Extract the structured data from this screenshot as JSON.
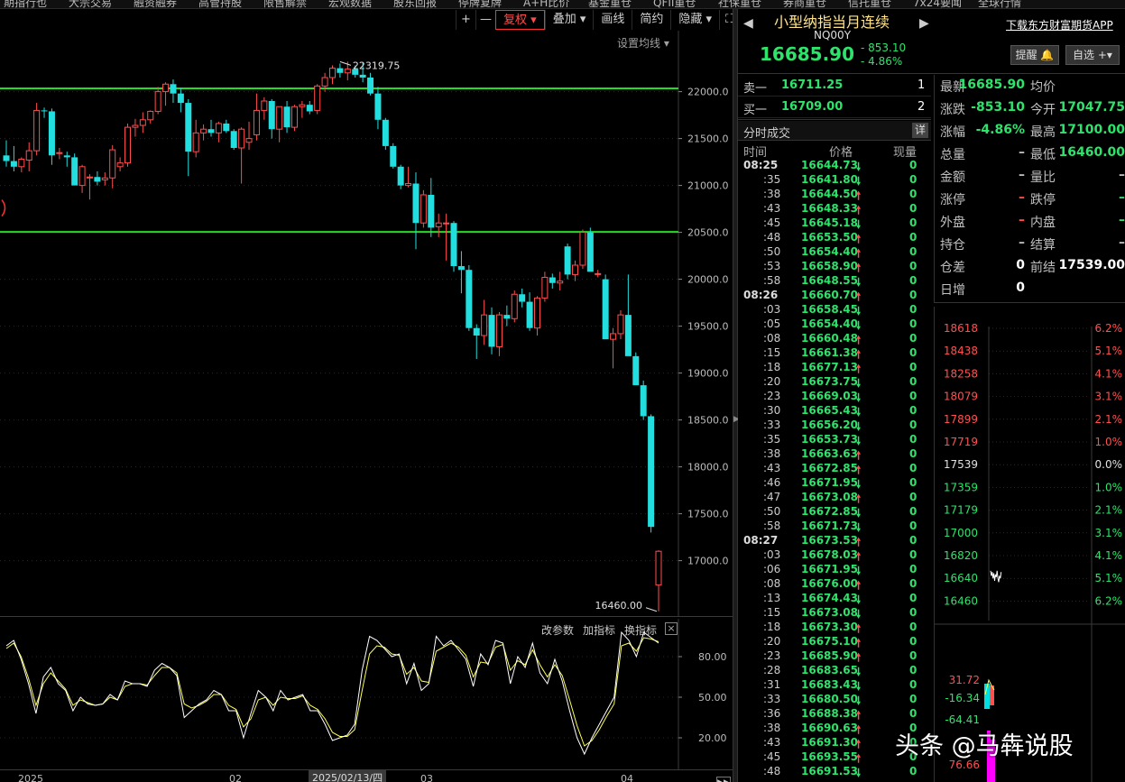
{
  "topbar": {
    "items": [
      "期指行也",
      "大宗交易",
      "融资融券",
      "高管持股",
      "限售解禁",
      "宏观数据",
      "股东回报",
      "停牌复牌",
      "A+H比价",
      "基金重仓",
      "QFII重仓",
      "社保重仓",
      "券商重仓",
      "信托重仓",
      "7x24要闻",
      "全球行情"
    ]
  },
  "toolbar": {
    "plus": "+",
    "minus": "—",
    "fuquan": "复权",
    "overlay": "叠加",
    "draw": "画线",
    "simple": "简约",
    "hide": "隐藏",
    "fullscreen": "⛶"
  },
  "setting_ma": "设置均线",
  "sub_toolbar": {
    "params": "改参数",
    "add": "加指标",
    "switch": "换指标",
    "close": "×"
  },
  "xaxis": {
    "labels": [
      "2025",
      "02",
      "03",
      "04"
    ],
    "cursor": "2025/02/13/四"
  },
  "quote": {
    "title": "小型纳指当月连续",
    "code": "NQ00Y",
    "last": "16685.90",
    "change": "- 853.10",
    "change_pct": "- 4.86%",
    "download": "下载东方财富期货APP",
    "alert": "提醒 🔔",
    "fav": "自选 +▾"
  },
  "book": [
    {
      "label": "卖一",
      "price": "16711.25",
      "vol": "1"
    },
    {
      "label": "买一",
      "price": "16709.00",
      "vol": "2"
    }
  ],
  "ticks_head": {
    "title": "分时成交",
    "detail": "详",
    "col_time": "时间",
    "col_price": "价格",
    "col_vol": "现量"
  },
  "ticks": [
    {
      "t": "08:25",
      "p": "16644.73",
      "d": "dn",
      "v": "0"
    },
    {
      "t": ":35",
      "p": "16641.80",
      "d": "dn",
      "v": "0"
    },
    {
      "t": ":38",
      "p": "16644.50",
      "d": "up",
      "v": "0"
    },
    {
      "t": ":43",
      "p": "16648.33",
      "d": "up",
      "v": "0"
    },
    {
      "t": ":45",
      "p": "16645.18",
      "d": "dn",
      "v": "0"
    },
    {
      "t": ":48",
      "p": "16653.50",
      "d": "up",
      "v": "0"
    },
    {
      "t": ":50",
      "p": "16654.40",
      "d": "up",
      "v": "0"
    },
    {
      "t": ":53",
      "p": "16658.90",
      "d": "up",
      "v": "0"
    },
    {
      "t": ":58",
      "p": "16648.55",
      "d": "dn",
      "v": "0"
    },
    {
      "t": "08:26",
      "p": "16660.70",
      "d": "up",
      "v": "0"
    },
    {
      "t": ":03",
      "p": "16658.45",
      "d": "dn",
      "v": "0"
    },
    {
      "t": ":05",
      "p": "16654.40",
      "d": "dn",
      "v": "0"
    },
    {
      "t": ":08",
      "p": "16660.48",
      "d": "up",
      "v": "0"
    },
    {
      "t": ":15",
      "p": "16661.38",
      "d": "up",
      "v": "0"
    },
    {
      "t": ":18",
      "p": "16677.13",
      "d": "up",
      "v": "0"
    },
    {
      "t": ":20",
      "p": "16673.75",
      "d": "dn",
      "v": "0"
    },
    {
      "t": ":23",
      "p": "16669.03",
      "d": "dn",
      "v": "0"
    },
    {
      "t": ":30",
      "p": "16665.43",
      "d": "dn",
      "v": "0"
    },
    {
      "t": ":33",
      "p": "16656.20",
      "d": "dn",
      "v": "0"
    },
    {
      "t": ":35",
      "p": "16653.73",
      "d": "dn",
      "v": "0"
    },
    {
      "t": ":38",
      "p": "16663.63",
      "d": "up",
      "v": "0"
    },
    {
      "t": ":43",
      "p": "16672.85",
      "d": "up",
      "v": "0"
    },
    {
      "t": ":46",
      "p": "16671.95",
      "d": "dn",
      "v": "0"
    },
    {
      "t": ":47",
      "p": "16673.08",
      "d": "up",
      "v": "0"
    },
    {
      "t": ":50",
      "p": "16672.85",
      "d": "dn",
      "v": "0"
    },
    {
      "t": ":58",
      "p": "16671.73",
      "d": "dn",
      "v": "0"
    },
    {
      "t": "08:27",
      "p": "16673.53",
      "d": "up",
      "v": "0"
    },
    {
      "t": ":03",
      "p": "16678.03",
      "d": "up",
      "v": "0"
    },
    {
      "t": ":06",
      "p": "16671.95",
      "d": "dn",
      "v": "0"
    },
    {
      "t": ":08",
      "p": "16676.00",
      "d": "up",
      "v": "0"
    },
    {
      "t": ":13",
      "p": "16674.43",
      "d": "dn",
      "v": "0"
    },
    {
      "t": ":15",
      "p": "16673.08",
      "d": "dn",
      "v": "0"
    },
    {
      "t": ":18",
      "p": "16673.30",
      "d": "up",
      "v": "0"
    },
    {
      "t": ":20",
      "p": "16675.10",
      "d": "up",
      "v": "0"
    },
    {
      "t": ":23",
      "p": "16685.90",
      "d": "up",
      "v": "0"
    },
    {
      "t": ":28",
      "p": "16683.65",
      "d": "dn",
      "v": "0"
    },
    {
      "t": ":31",
      "p": "16683.43",
      "d": "dn",
      "v": "0"
    },
    {
      "t": ":33",
      "p": "16680.50",
      "d": "dn",
      "v": "0"
    },
    {
      "t": ":36",
      "p": "16688.38",
      "d": "up",
      "v": "0"
    },
    {
      "t": ":38",
      "p": "16690.63",
      "d": "up",
      "v": "0"
    },
    {
      "t": ":43",
      "p": "16691.30",
      "d": "up",
      "v": "0"
    },
    {
      "t": ":45",
      "p": "16693.55",
      "d": "up",
      "v": "0"
    },
    {
      "t": ":48",
      "p": "16691.53",
      "d": "dn",
      "v": "0"
    }
  ],
  "stats": {
    "rows": [
      {
        "l1": "最新",
        "v1": "16685.90",
        "c1": "#2ee36b",
        "l2": "均价",
        "v2": "",
        "c2": "#c0c0c0"
      },
      {
        "l1": "涨跌",
        "v1": "-853.10",
        "c1": "#2ee36b",
        "l2": "今开",
        "v2": "17047.75",
        "c2": "#2ee36b"
      },
      {
        "l1": "涨幅",
        "v1": "-4.86%",
        "c1": "#2ee36b",
        "l2": "最高",
        "v2": "17100.00",
        "c2": "#2ee36b"
      },
      {
        "l1": "总量",
        "v1": "–",
        "c1": "#c0c0c0",
        "l2": "最低",
        "v2": "16460.00",
        "c2": "#2ee36b"
      },
      {
        "l1": "金额",
        "v1": "–",
        "c1": "#c0c0c0",
        "l2": "量比",
        "v2": "–",
        "c2": "#c0c0c0"
      },
      {
        "l1": "涨停",
        "v1": "–",
        "c1": "#ff5050",
        "l2": "跌停",
        "v2": "–",
        "c2": "#2ee36b"
      },
      {
        "l1": "外盘",
        "v1": "–",
        "c1": "#ff5050",
        "l2": "内盘",
        "v2": "–",
        "c2": "#2ee36b"
      },
      {
        "l1": "持仓",
        "v1": "–",
        "c1": "#c0c0c0",
        "l2": "结算",
        "v2": "–",
        "c2": "#c0c0c0"
      },
      {
        "l1": "仓差",
        "v1": "0",
        "c1": "#ffffff",
        "l2": "前结",
        "v2": "17539.00",
        "c2": "#ffffff"
      },
      {
        "l1": "日增",
        "v1": "0",
        "c1": "#ffffff",
        "l2": "",
        "v2": "",
        "c2": "#c0c0c0"
      }
    ]
  },
  "mini": {
    "prices": [
      "18618",
      "18438",
      "18258",
      "18079",
      "17899",
      "17719",
      "17539",
      "17359",
      "17179",
      "17000",
      "16820",
      "16640",
      "16460"
    ],
    "pcts": [
      "6.2%",
      "5.1%",
      "4.1%",
      "3.1%",
      "2.1%",
      "1.0%",
      "0.0%",
      "1.0%",
      "2.1%",
      "3.1%",
      "4.1%",
      "5.1%",
      "6.2%"
    ],
    "vol_labels": [
      "31.72",
      "-16.34",
      "-64.41",
      "76.66"
    ]
  },
  "watermark": "头条 @马犇说股",
  "chart_data": {
    "type": "candlestick",
    "title": "",
    "y_ticks": [
      22000,
      21500,
      21000,
      20500,
      20000,
      19500,
      19000,
      18500,
      18000,
      17500,
      17000
    ],
    "ylim": [
      16400,
      22650
    ],
    "annotations": {
      "high": "22319.75",
      "low": "16460.00"
    },
    "h_lines": [
      22035,
      20505
    ],
    "colors": {
      "up": "#ff4d4d",
      "down": "#22dede",
      "level": "#22dd22",
      "k": "#ffffff",
      "d": "#ffff55"
    },
    "candles": [
      [
        21320,
        21480,
        21200,
        21260
      ],
      [
        21260,
        21420,
        21150,
        21200
      ],
      [
        21200,
        21300,
        21140,
        21280
      ],
      [
        21270,
        21460,
        21150,
        21370
      ],
      [
        21370,
        21880,
        21320,
        21800
      ],
      [
        21800,
        21830,
        21720,
        21790
      ],
      [
        21790,
        21820,
        21220,
        21320
      ],
      [
        21340,
        21400,
        21280,
        21350
      ],
      [
        21320,
        21360,
        21200,
        21300
      ],
      [
        21300,
        21340,
        21000,
        21000
      ],
      [
        21000,
        21220,
        20920,
        21200
      ],
      [
        21080,
        21120,
        20850,
        21090
      ],
      [
        21090,
        21150,
        21000,
        21040
      ],
      [
        21060,
        21140,
        21000,
        21080
      ],
      [
        21080,
        21430,
        20970,
        21380
      ],
      [
        21200,
        21300,
        21150,
        21240
      ],
      [
        21240,
        21660,
        21200,
        21620
      ],
      [
        21620,
        21710,
        21520,
        21640
      ],
      [
        21640,
        21780,
        21560,
        21700
      ],
      [
        21700,
        21800,
        21660,
        21790
      ],
      [
        21790,
        22050,
        21760,
        22000
      ],
      [
        22000,
        22100,
        21850,
        22080
      ],
      [
        22080,
        22130,
        21880,
        21980
      ],
      [
        21980,
        22040,
        21780,
        21880
      ],
      [
        21880,
        21920,
        21100,
        21360
      ],
      [
        21360,
        21700,
        21300,
        21560
      ],
      [
        21560,
        21650,
        21480,
        21600
      ],
      [
        21600,
        21700,
        21520,
        21560
      ],
      [
        21560,
        21680,
        21460,
        21660
      ],
      [
        21660,
        21700,
        21560,
        21580
      ],
      [
        21580,
        21600,
        21380,
        21400
      ],
      [
        21400,
        21620,
        21020,
        21600
      ],
      [
        21460,
        21680,
        21380,
        21500
      ],
      [
        21540,
        21980,
        21480,
        21800
      ],
      [
        21800,
        21940,
        21700,
        21900
      ],
      [
        21900,
        21920,
        21500,
        21600
      ],
      [
        21600,
        21840,
        21460,
        21840
      ],
      [
        21840,
        21900,
        21560,
        21620
      ],
      [
        21620,
        21860,
        21580,
        21840
      ],
      [
        21840,
        21900,
        21720,
        21860
      ],
      [
        21860,
        21900,
        21760,
        21790
      ],
      [
        21800,
        22080,
        21760,
        22060
      ],
      [
        22060,
        22200,
        22000,
        22150
      ],
      [
        22150,
        22280,
        22080,
        22250
      ],
      [
        22250,
        22300,
        22150,
        22200
      ],
      [
        22200,
        22320,
        22120,
        22240
      ],
      [
        22240,
        22280,
        22150,
        22180
      ],
      [
        22180,
        22310,
        22100,
        22150
      ],
      [
        22150,
        22200,
        21960,
        21980
      ],
      [
        21980,
        22050,
        21600,
        21700
      ],
      [
        21700,
        21720,
        21380,
        21420
      ],
      [
        21420,
        21450,
        21180,
        21200
      ],
      [
        21200,
        21220,
        20960,
        21000
      ],
      [
        21000,
        21200,
        20980,
        21020
      ],
      [
        21020,
        21140,
        20320,
        20600
      ],
      [
        20600,
        20950,
        20550,
        20900
      ],
      [
        20900,
        21080,
        20450,
        20550
      ],
      [
        20560,
        20700,
        20450,
        20600
      ],
      [
        20600,
        20700,
        20200,
        20600
      ],
      [
        20600,
        20620,
        20080,
        20140
      ],
      [
        20140,
        20300,
        19850,
        20100
      ],
      [
        20100,
        20150,
        19450,
        19480
      ],
      [
        19480,
        19520,
        19150,
        19400
      ],
      [
        19400,
        19780,
        19300,
        19620
      ],
      [
        19620,
        19700,
        19200,
        19280
      ],
      [
        19280,
        19650,
        19180,
        19620
      ],
      [
        19620,
        19720,
        19500,
        19580
      ],
      [
        19580,
        19880,
        19540,
        19840
      ],
      [
        19840,
        19900,
        19700,
        19760
      ],
      [
        19760,
        19860,
        19450,
        19480
      ],
      [
        19480,
        19820,
        19400,
        19800
      ],
      [
        19800,
        20080,
        19760,
        20020
      ],
      [
        20020,
        20060,
        19900,
        19960
      ],
      [
        19960,
        20080,
        19880,
        19980
      ],
      [
        20350,
        20380,
        20000,
        20050
      ],
      [
        20050,
        20200,
        19980,
        20150
      ],
      [
        20150,
        20530,
        20110,
        20500
      ],
      [
        20500,
        20550,
        20150,
        20080
      ],
      [
        20060,
        20100,
        20020,
        20060
      ],
      [
        20000,
        20050,
        19400,
        19360
      ],
      [
        19360,
        19480,
        19050,
        19420
      ],
      [
        19420,
        19670,
        19360,
        19620
      ],
      [
        19620,
        20050,
        19200,
        19180
      ],
      [
        19180,
        19220,
        18880,
        18870
      ],
      [
        18870,
        18920,
        18500,
        18540
      ],
      [
        18540,
        18560,
        17300,
        17360
      ],
      [
        16740,
        17110,
        16460,
        17100
      ]
    ],
    "kdj_k": [
      88,
      92,
      78,
      60,
      38,
      65,
      72,
      60,
      55,
      40,
      50,
      45,
      44,
      45,
      52,
      48,
      62,
      60,
      60,
      58,
      70,
      75,
      72,
      66,
      35,
      40,
      45,
      48,
      55,
      52,
      40,
      40,
      20,
      38,
      55,
      50,
      40,
      55,
      48,
      50,
      52,
      40,
      40,
      30,
      18,
      20,
      22,
      30,
      70,
      95,
      92,
      86,
      80,
      82,
      60,
      75,
      55,
      60,
      95,
      88,
      92,
      85,
      78,
      58,
      82,
      74,
      92,
      90,
      60,
      80,
      72,
      90,
      68,
      60,
      78,
      62,
      40,
      20,
      8,
      20,
      30,
      40,
      50,
      98,
      92,
      80,
      98,
      94,
      90
    ],
    "kdj_d": [
      86,
      90,
      80,
      64,
      44,
      60,
      68,
      62,
      56,
      44,
      48,
      46,
      44,
      45,
      50,
      48,
      58,
      60,
      60,
      59,
      66,
      72,
      72,
      68,
      45,
      42,
      44,
      47,
      52,
      52,
      44,
      41,
      28,
      34,
      48,
      50,
      44,
      50,
      49,
      49,
      51,
      44,
      41,
      34,
      24,
      21,
      21,
      26,
      55,
      82,
      88,
      87,
      82,
      81,
      67,
      72,
      62,
      61,
      84,
      87,
      90,
      87,
      81,
      65,
      76,
      75,
      87,
      89,
      70,
      77,
      74,
      85,
      74,
      65,
      74,
      66,
      48,
      29,
      14,
      18,
      26,
      36,
      45,
      88,
      90,
      84,
      94,
      93,
      91
    ]
  }
}
